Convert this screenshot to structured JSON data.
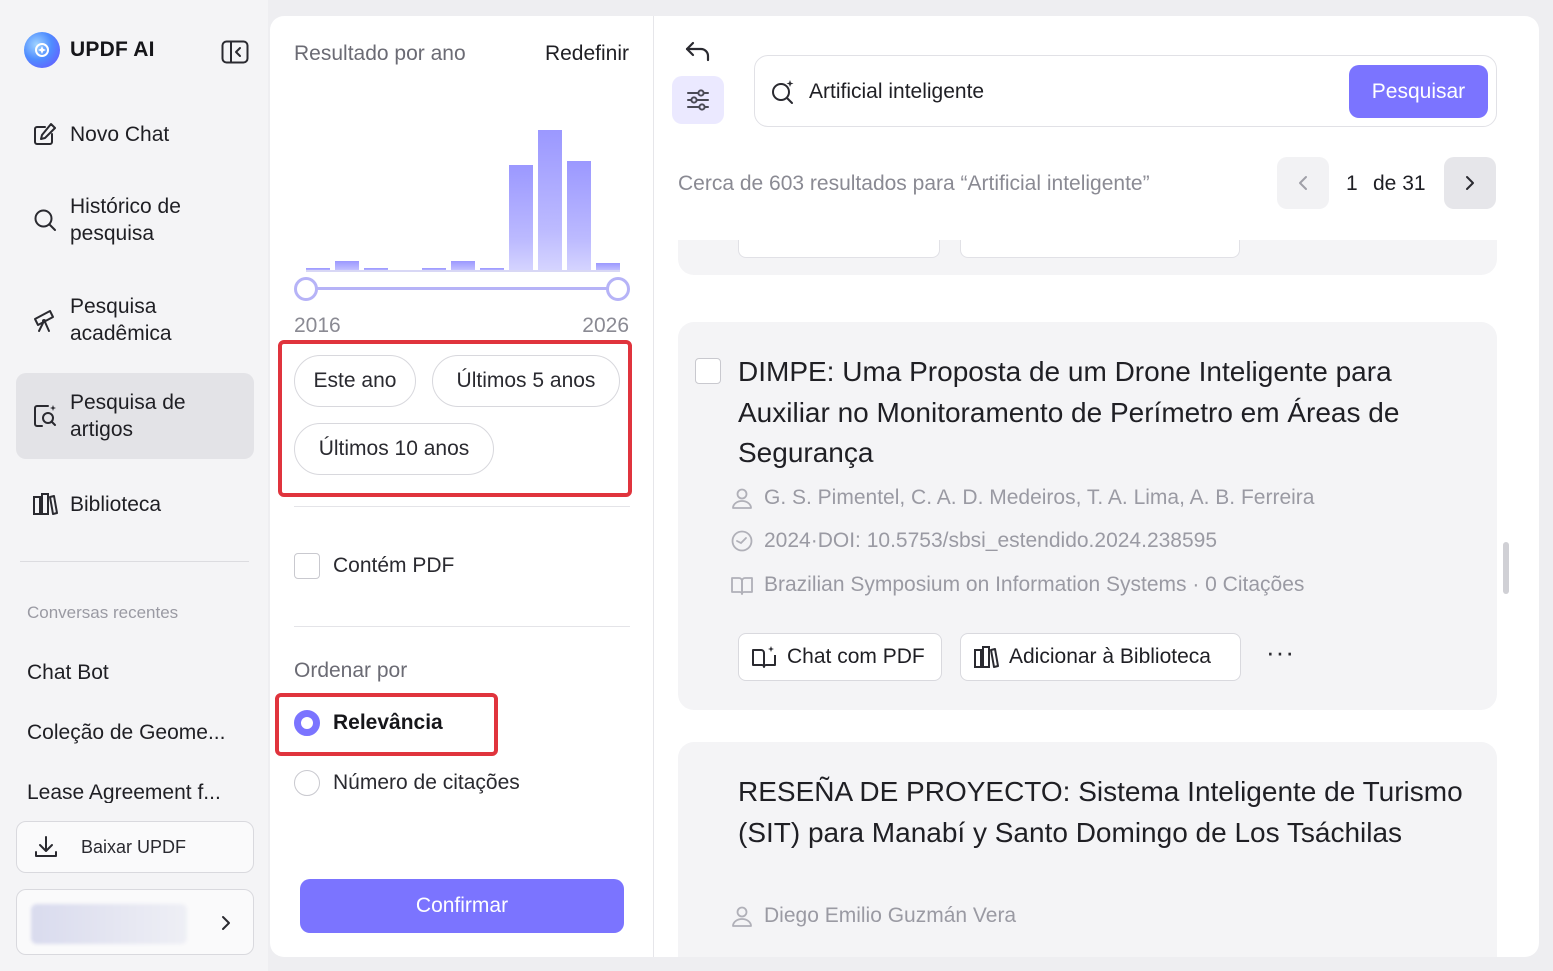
{
  "sidebar": {
    "brand": "UPDF AI",
    "nav": [
      {
        "label": "Novo Chat",
        "icon": "edit-icon"
      },
      {
        "label": "Histórico de pesquisa",
        "icon": "search-icon"
      },
      {
        "label": "Pesquisa acadêmica",
        "icon": "telescope-icon"
      },
      {
        "label": "Pesquisa de artigos",
        "icon": "article-search-icon",
        "active": true
      },
      {
        "label": "Biblioteca",
        "icon": "library-icon"
      }
    ],
    "recent_header": "Conversas recentes",
    "recent": [
      "Chat Bot",
      "Coleção de Geome...",
      "Lease Agreement f..."
    ],
    "download_label": "Baixar UPDF"
  },
  "filter": {
    "title": "Resultado por ano",
    "reset": "Redefinir",
    "year_start": "2016",
    "year_end": "2026",
    "histogram": [
      0.03,
      0.08,
      0.03,
      0.0,
      0.03,
      0.08,
      0.03,
      0.75,
      1.0,
      0.78,
      0.06
    ],
    "ranges": [
      "Este ano",
      "Últimos 5 anos",
      "Últimos 10 anos"
    ],
    "contains_pdf": "Contém PDF",
    "sort_title": "Ordenar por",
    "sort_options": [
      "Relevância",
      "Número de citações"
    ],
    "confirm": "Confirmar"
  },
  "search": {
    "query": "Artificial inteligente",
    "button": "Pesquisar",
    "summary": "Cerca de 603 resultados para   “Artificial inteligente”",
    "page": "1",
    "page_of": "de 31"
  },
  "results": [
    {
      "title": "DIMPE: Uma Proposta de um Drone Inteligente para Auxiliar no Monitoramento de Perímetro em Áreas de Segurança",
      "authors": "G. S. Pimentel,  C. A. D. Medeiros,  T. A. Lima,  A. B. Ferreira",
      "date_doi": "2024·DOI: 10.5753/sbsi_estendido.2024.238595",
      "venue": "Brazilian Symposium on Information Systems · 0 Citações",
      "chat_pdf": "Chat com PDF",
      "add_library": "Adicionar à Biblioteca",
      "more": "···"
    },
    {
      "title": "RESEÑA DE PROYECTO: Sistema Inteligente de Turismo (SIT) para Manabí y Santo Domingo de Los Tsáchilas",
      "authors": "Diego Emilio Guzmán Vera"
    }
  ],
  "colors": {
    "accent": "#7b74ff",
    "highlight": "#e0343d"
  }
}
